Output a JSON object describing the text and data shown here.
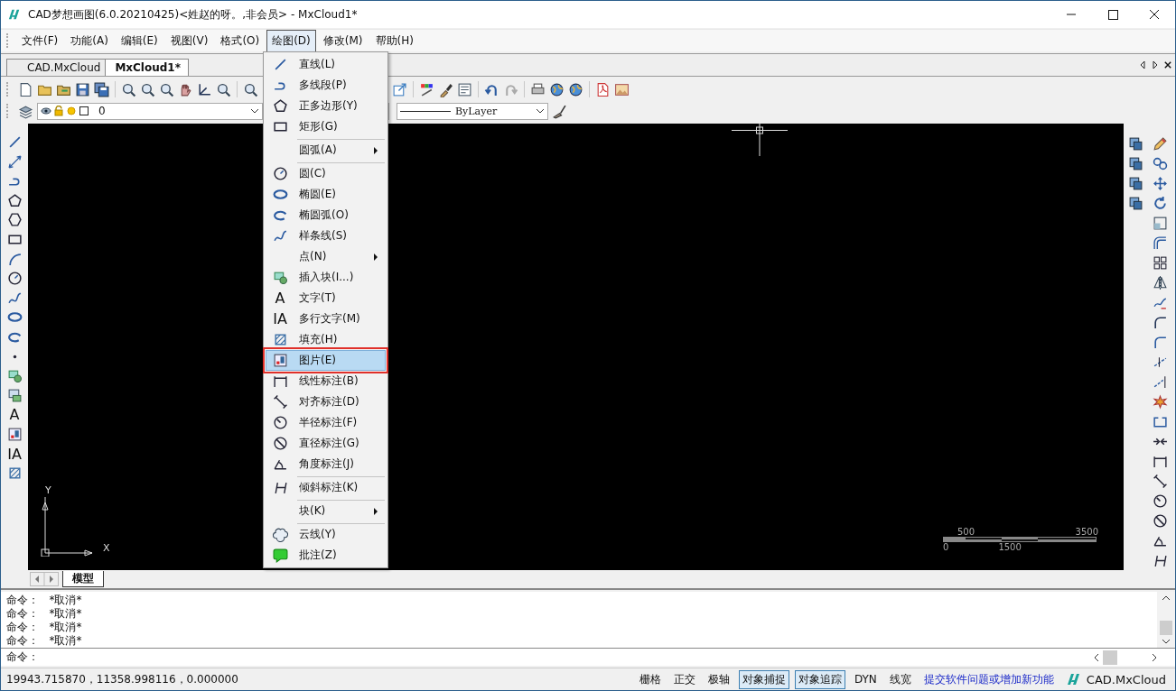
{
  "window": {
    "title": "CAD梦想画图(6.0.20210425)<姓赵的呀。,非会员> - MxCloud1*"
  },
  "menu_bar": [
    {
      "label": "文件(F)",
      "selected": false
    },
    {
      "label": "功能(A)",
      "selected": false
    },
    {
      "label": "编辑(E)",
      "selected": false
    },
    {
      "label": "视图(V)",
      "selected": false
    },
    {
      "label": "格式(O)",
      "selected": false
    },
    {
      "label": "绘图(D)",
      "selected": true
    },
    {
      "label": "修改(M)",
      "selected": false
    },
    {
      "label": "帮助(H)",
      "selected": false
    }
  ],
  "document_tabs": [
    {
      "label": "CAD.MxCloud",
      "selected": false
    },
    {
      "label": "MxCloud1*",
      "selected": true
    }
  ],
  "layer_combo": {
    "value": "0"
  },
  "linetype_combo": {
    "value": "ByLayer"
  },
  "draw_menu": [
    {
      "label": "直线(L)",
      "submenu": false,
      "separator_before": false,
      "selected": false
    },
    {
      "label": "多线段(P)",
      "submenu": false,
      "separator_before": false,
      "selected": false
    },
    {
      "label": "正多边形(Y)",
      "submenu": false,
      "separator_before": false,
      "selected": false
    },
    {
      "label": "矩形(G)",
      "submenu": false,
      "separator_before": false,
      "selected": false
    },
    {
      "label": "圆弧(A)",
      "submenu": true,
      "separator_before": true,
      "selected": false
    },
    {
      "label": "圆(C)",
      "submenu": false,
      "separator_before": true,
      "selected": false
    },
    {
      "label": "椭圆(E)",
      "submenu": false,
      "separator_before": false,
      "selected": false
    },
    {
      "label": "椭圆弧(O)",
      "submenu": false,
      "separator_before": false,
      "selected": false
    },
    {
      "label": "样条线(S)",
      "submenu": false,
      "separator_before": false,
      "selected": false
    },
    {
      "label": "点(N)",
      "submenu": true,
      "separator_before": false,
      "selected": false
    },
    {
      "label": "插入块(I...)",
      "submenu": false,
      "separator_before": false,
      "selected": false
    },
    {
      "label": "文字(T)",
      "submenu": false,
      "separator_before": false,
      "selected": false,
      "glyph": "A"
    },
    {
      "label": "多行文字(M)",
      "submenu": false,
      "separator_before": false,
      "selected": false,
      "glyph": "IA"
    },
    {
      "label": "填充(H)",
      "submenu": false,
      "separator_before": false,
      "selected": false
    },
    {
      "label": "图片(E)",
      "submenu": false,
      "separator_before": false,
      "selected": true
    },
    {
      "label": "线性标注(B)",
      "submenu": false,
      "separator_before": false,
      "selected": false
    },
    {
      "label": "对齐标注(D)",
      "submenu": false,
      "separator_before": false,
      "selected": false
    },
    {
      "label": "半径标注(F)",
      "submenu": false,
      "separator_before": false,
      "selected": false
    },
    {
      "label": "直径标注(G)",
      "submenu": false,
      "separator_before": false,
      "selected": false
    },
    {
      "label": "角度标注(J)",
      "submenu": false,
      "separator_before": false,
      "selected": false
    },
    {
      "label": "倾斜标注(K)",
      "submenu": false,
      "separator_before": true,
      "selected": false
    },
    {
      "label": "块(K)",
      "submenu": true,
      "separator_before": true,
      "selected": false
    },
    {
      "label": "云线(Y)",
      "submenu": false,
      "separator_before": true,
      "selected": false
    },
    {
      "label": "批注(Z)",
      "submenu": false,
      "separator_before": false,
      "selected": false
    }
  ],
  "left_toolbar": {
    "text_icons": [
      "A",
      "IA"
    ]
  },
  "canvas": {
    "ucs_labels": [
      "Y",
      "X"
    ],
    "scale_bar": {
      "top_labels": [
        "500",
        "3500"
      ],
      "bottom_labels": [
        "0",
        "1500"
      ]
    }
  },
  "layout_tabs": [
    {
      "label": "模型",
      "selected": true
    }
  ],
  "command_history": [
    "命令：   *取消*",
    "命令：   *取消*",
    "命令：   *取消*",
    "命令：   *取消*"
  ],
  "command_prompt": "命令：",
  "status_bar": {
    "coordinates": "19943.715870，11358.998116，0.000000",
    "toggles": [
      {
        "label": "栅格",
        "on": false
      },
      {
        "label": "正交",
        "on": false
      },
      {
        "label": "极轴",
        "on": false
      },
      {
        "label": "对象捕捉",
        "on": true
      },
      {
        "label": "对象追踪",
        "on": true
      },
      {
        "label": "DYN",
        "on": false
      },
      {
        "label": "线宽",
        "on": false
      }
    ],
    "link": "提交软件问题或增加新功能",
    "brand": "CAD.MxCloud"
  }
}
